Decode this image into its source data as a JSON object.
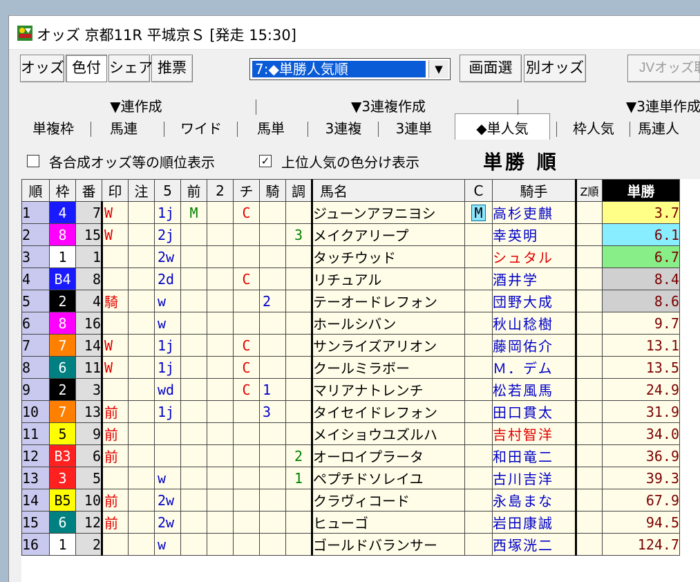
{
  "title": "オッズ 京都11R 平城京Ｓ  [発走 15:30]",
  "toolbar": {
    "buttons": [
      "オッズ",
      "色付",
      "シェア",
      "推票"
    ],
    "view_select_value": "7:◆単勝人気順",
    "screen_select": "画面選",
    "other_odds": "別オッズ",
    "jv_odds": "JVオッズ取"
  },
  "tabs_top": [
    "▼連作成",
    "▼3連複作成",
    "▼3連単作成"
  ],
  "tabs": [
    "単複枠",
    "馬連",
    "ワイド",
    "馬単",
    "3連複",
    "3連単",
    "◆単人気",
    "枠人気",
    "馬連人"
  ],
  "options": {
    "show_rank_label": "各合成オッズ等の順位表示",
    "show_rank_checked": false,
    "color_top_label": "上位人気の色分け表示",
    "color_top_checked": true,
    "check_mark": "✓",
    "sort_title": "単勝 順"
  },
  "columns": [
    "順",
    "枠",
    "番",
    "印",
    "注",
    "5",
    "前",
    "2",
    "チ",
    "騎",
    "調",
    "馬名",
    "C",
    "騎手",
    "Z順",
    "単勝"
  ],
  "colors": {
    "waku": {
      "1": "#ffffff",
      "2": "#000000",
      "3": "#ff2020",
      "4": "#1a1aff",
      "5": "#ffff00",
      "6": "#008080",
      "7": "#ff8000",
      "8": "#ff00ff"
    },
    "waku_text": {
      "1": "#000000",
      "2": "#ffffff",
      "3": "#ffffff",
      "4": "#ffffff",
      "5": "#000000",
      "6": "#ffffff",
      "7": "#ffffff",
      "8": "#ffffff"
    },
    "odds_top": [
      "#ffff88",
      "#88eeff",
      "#88ee88"
    ],
    "odds_other": "#d0d0d0",
    "red": "#e00000",
    "blue": "#0000c8",
    "green": "#008000"
  },
  "rows": [
    {
      "rank": "1",
      "waku": "4",
      "waku_label": "4",
      "num": "7",
      "mark": "W",
      "five": "1j",
      "mae": "M",
      "ni": "",
      "chi": "C",
      "ki": "",
      "cho": "",
      "name": "ジューンアヲニヨシ",
      "c": "M",
      "jockey": "高杉吏麒",
      "jockey_color": "blue",
      "z": "",
      "odds": "3.7"
    },
    {
      "rank": "2",
      "waku": "8",
      "waku_label": "8",
      "num": "15",
      "mark": "W",
      "five": "2j",
      "mae": "",
      "ni": "",
      "chi": "",
      "ki": "",
      "cho": "3",
      "name": "メイクアリープ",
      "c": "",
      "jockey": "幸英明",
      "jockey_color": "blue",
      "z": "",
      "odds": "6.1"
    },
    {
      "rank": "3",
      "waku": "1",
      "waku_label": "1",
      "num": "1",
      "mark": "",
      "five": "2w",
      "mae": "",
      "ni": "",
      "chi": "",
      "ki": "",
      "cho": "",
      "name": "タッチウッド",
      "c": "",
      "jockey": "シュタル",
      "jockey_color": "red",
      "z": "",
      "odds": "6.7"
    },
    {
      "rank": "4",
      "waku": "4",
      "waku_label": "B4",
      "num": "8",
      "mark": "",
      "five": "2d",
      "mae": "",
      "ni": "",
      "chi": "C",
      "ki": "",
      "cho": "",
      "name": "リチュアル",
      "c": "",
      "jockey": "酒井学",
      "jockey_color": "blue",
      "z": "",
      "odds": "8.4"
    },
    {
      "rank": "5",
      "waku": "2",
      "waku_label": "2",
      "num": "4",
      "mark": "騎",
      "five": "w",
      "mae": "",
      "ni": "",
      "chi": "",
      "ki": "2",
      "cho": "",
      "name": "テーオードレフォン",
      "c": "",
      "jockey": "団野大成",
      "jockey_color": "blue",
      "z": "",
      "odds": "8.6"
    },
    {
      "rank": "6",
      "waku": "8",
      "waku_label": "8",
      "num": "16",
      "mark": "",
      "five": "w",
      "mae": "",
      "ni": "",
      "chi": "",
      "ki": "",
      "cho": "",
      "name": "ホールシバン",
      "c": "",
      "jockey": "秋山稔樹",
      "jockey_color": "blue",
      "z": "",
      "odds": "9.7"
    },
    {
      "rank": "7",
      "waku": "7",
      "waku_label": "7",
      "num": "14",
      "mark": "W",
      "five": "1j",
      "mae": "",
      "ni": "",
      "chi": "C",
      "ki": "",
      "cho": "",
      "name": "サンライズアリオン",
      "c": "",
      "jockey": "藤岡佑介",
      "jockey_color": "blue",
      "z": "",
      "odds": "13.1"
    },
    {
      "rank": "8",
      "waku": "6",
      "waku_label": "6",
      "num": "11",
      "mark": "W",
      "five": "1j",
      "mae": "",
      "ni": "",
      "chi": "C",
      "ki": "",
      "cho": "",
      "name": "クールミラボー",
      "c": "",
      "jockey": "Ｍ．デム",
      "jockey_color": "blue",
      "z": "",
      "odds": "13.5"
    },
    {
      "rank": "9",
      "waku": "2",
      "waku_label": "2",
      "num": "3",
      "mark": "",
      "five": "wd",
      "mae": "",
      "ni": "",
      "chi": "C",
      "ki": "1",
      "cho": "",
      "name": "マリアナトレンチ",
      "c": "",
      "jockey": "松若風馬",
      "jockey_color": "blue",
      "z": "",
      "odds": "24.9"
    },
    {
      "rank": "10",
      "waku": "7",
      "waku_label": "7",
      "num": "13",
      "mark": "前",
      "five": "1j",
      "mae": "",
      "ni": "",
      "chi": "",
      "ki": "3",
      "cho": "",
      "name": "タイセイドレフォン",
      "c": "",
      "jockey": "田口貫太",
      "jockey_color": "blue",
      "z": "",
      "odds": "31.9"
    },
    {
      "rank": "11",
      "waku": "5",
      "waku_label": "5",
      "num": "9",
      "mark": "前",
      "five": "",
      "mae": "",
      "ni": "",
      "chi": "",
      "ki": "",
      "cho": "",
      "name": "メイショウユズルハ",
      "c": "",
      "jockey": "吉村智洋",
      "jockey_color": "red",
      "z": "",
      "odds": "34.0"
    },
    {
      "rank": "12",
      "waku": "3",
      "waku_label": "B3",
      "num": "6",
      "mark": "前",
      "five": "",
      "mae": "",
      "ni": "",
      "chi": "",
      "ki": "",
      "cho": "2",
      "name": "オーロイプラータ",
      "c": "",
      "jockey": "和田竜二",
      "jockey_color": "blue",
      "z": "",
      "odds": "36.9"
    },
    {
      "rank": "13",
      "waku": "3",
      "waku_label": "3",
      "num": "5",
      "mark": "",
      "five": "w",
      "mae": "",
      "ni": "",
      "chi": "",
      "ki": "",
      "cho": "1",
      "name": "ペプチドソレイユ",
      "c": "",
      "jockey": "古川吉洋",
      "jockey_color": "blue",
      "z": "",
      "odds": "39.3"
    },
    {
      "rank": "14",
      "waku": "5",
      "waku_label": "B5",
      "num": "10",
      "mark": "前",
      "five": "2w",
      "mae": "",
      "ni": "",
      "chi": "",
      "ki": "",
      "cho": "",
      "name": "クラヴィコード",
      "c": "",
      "jockey": "永島まな",
      "jockey_color": "blue",
      "z": "",
      "odds": "67.9"
    },
    {
      "rank": "15",
      "waku": "6",
      "waku_label": "6",
      "num": "12",
      "mark": "前",
      "five": "2w",
      "mae": "",
      "ni": "",
      "chi": "",
      "ki": "",
      "cho": "",
      "name": "ヒューゴ",
      "c": "",
      "jockey": "岩田康誠",
      "jockey_color": "blue",
      "z": "",
      "odds": "94.5"
    },
    {
      "rank": "16",
      "waku": "1",
      "waku_label": "1",
      "num": "2",
      "mark": "",
      "five": "w",
      "mae": "",
      "ni": "",
      "chi": "",
      "ki": "",
      "cho": "",
      "name": "ゴールドバランサー",
      "c": "",
      "jockey": "西塚洸二",
      "jockey_color": "blue",
      "z": "",
      "odds": "124.7"
    }
  ]
}
